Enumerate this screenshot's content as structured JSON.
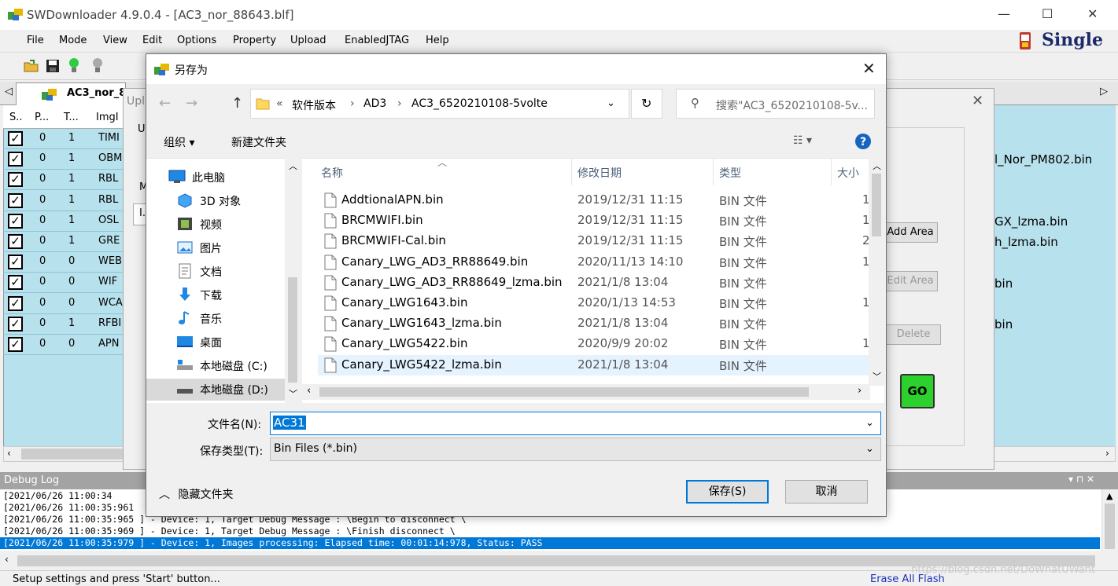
{
  "app": {
    "title": "SWDownloader 4.9.0.4 - [AC3_nor_88643.blf]",
    "mode_label": "Single",
    "menu": [
      "File",
      "Mode",
      "View",
      "Edit",
      "Options",
      "Property",
      "Upload",
      "EnabledJTAG",
      "Help"
    ],
    "tab_label": "AC3_nor_8",
    "grid_headers": [
      "S..",
      "P...",
      "T...",
      "ImgI"
    ],
    "grid_rows": [
      {
        "p": "0",
        "t": "1",
        "img": "TIMI"
      },
      {
        "p": "0",
        "t": "1",
        "img": "OBM"
      },
      {
        "p": "0",
        "t": "1",
        "img": "RBL"
      },
      {
        "p": "0",
        "t": "1",
        "img": "RBL"
      },
      {
        "p": "0",
        "t": "1",
        "img": "OSL"
      },
      {
        "p": "0",
        "t": "1",
        "img": "GRE"
      },
      {
        "p": "0",
        "t": "0",
        "img": "WEB"
      },
      {
        "p": "0",
        "t": "0",
        "img": "WIF"
      },
      {
        "p": "0",
        "t": "0",
        "img": "WCA"
      },
      {
        "p": "0",
        "t": "1",
        "img": "RFBI"
      },
      {
        "p": "0",
        "t": "0",
        "img": "APN"
      }
    ],
    "grid_right_texts": [
      "l_Nor_PM802.bin",
      "GX_lzma.bin",
      "h_lzma.bin",
      "bin",
      "bin"
    ],
    "debug_log_title": "Debug Log",
    "debug_lines": [
      "[2021/06/26 11:00:34",
      "[2021/06/26 11:00:35:961",
      "[2021/06/26 11:00:35:965 ] - Device: 1, Target Debug Message : \\Begin to disconnect \\",
      "[2021/06/26 11:00:35:969 ] - Device: 1, Target Debug Message : \\Finish disconnect \\",
      "[2021/06/26 11:00:35:979 ] - Device: 1, Images processing: Elapsed time: 00:01:14:978, Status: PASS"
    ],
    "status_text": "Setup settings and press 'Start' button...",
    "erase_label": "Erase All Flash",
    "watermark": "https://blog.csdn.net/DoWhatUWant"
  },
  "upload_dialog": {
    "title_partial": "Upl",
    "label_u": "U",
    "label_m": "M",
    "input_partial": "I.",
    "add_area": "Add Area",
    "edit_area": "Edit Area",
    "delete": "Delete",
    "go": "GO"
  },
  "save_dialog": {
    "title": "另存为",
    "breadcrumb": [
      "«",
      "软件版本",
      "›",
      "AD3",
      "›",
      "AC3_6520210108-5volte"
    ],
    "search_placeholder": "搜索\"AC3_6520210108-5v...",
    "organize": "组织 ▾",
    "new_folder": "新建文件夹",
    "nav_items": [
      "此电脑",
      "3D 对象",
      "视频",
      "图片",
      "文档",
      "下载",
      "音乐",
      "桌面",
      "本地磁盘 (C:)",
      "本地磁盘 (D:)"
    ],
    "columns": {
      "name": "名称",
      "date": "修改日期",
      "type": "类型",
      "size": "大小"
    },
    "files": [
      {
        "name": "AddtionalAPN.bin",
        "date": "2019/12/31 11:15",
        "type": "BIN 文件",
        "size": "1"
      },
      {
        "name": "BRCMWIFI.bin",
        "date": "2019/12/31 11:15",
        "type": "BIN 文件",
        "size": "1"
      },
      {
        "name": "BRCMWIFI-Cal.bin",
        "date": "2019/12/31 11:15",
        "type": "BIN 文件",
        "size": "2"
      },
      {
        "name": "Canary_LWG_AD3_RR88649.bin",
        "date": "2020/11/13 14:10",
        "type": "BIN 文件",
        "size": "1"
      },
      {
        "name": "Canary_LWG_AD3_RR88649_lzma.bin",
        "date": "2021/1/8 13:04",
        "type": "BIN 文件",
        "size": ""
      },
      {
        "name": "Canary_LWG1643.bin",
        "date": "2020/1/13 14:53",
        "type": "BIN 文件",
        "size": "1"
      },
      {
        "name": "Canary_LWG1643_lzma.bin",
        "date": "2021/1/8 13:04",
        "type": "BIN 文件",
        "size": ""
      },
      {
        "name": "Canary_LWG5422.bin",
        "date": "2020/9/9 20:02",
        "type": "BIN 文件",
        "size": "1"
      },
      {
        "name": "Canary_LWG5422_lzma.bin",
        "date": "2021/1/8 13:04",
        "type": "BIN 文件",
        "size": ""
      }
    ],
    "file_name_label": "文件名(N):",
    "file_name_value": "AC31",
    "file_type_label": "保存类型(T):",
    "file_type_value": "Bin Files (*.bin)",
    "save_button": "保存(S)",
    "cancel_button": "取消",
    "hide_folders": "隐藏文件夹"
  }
}
